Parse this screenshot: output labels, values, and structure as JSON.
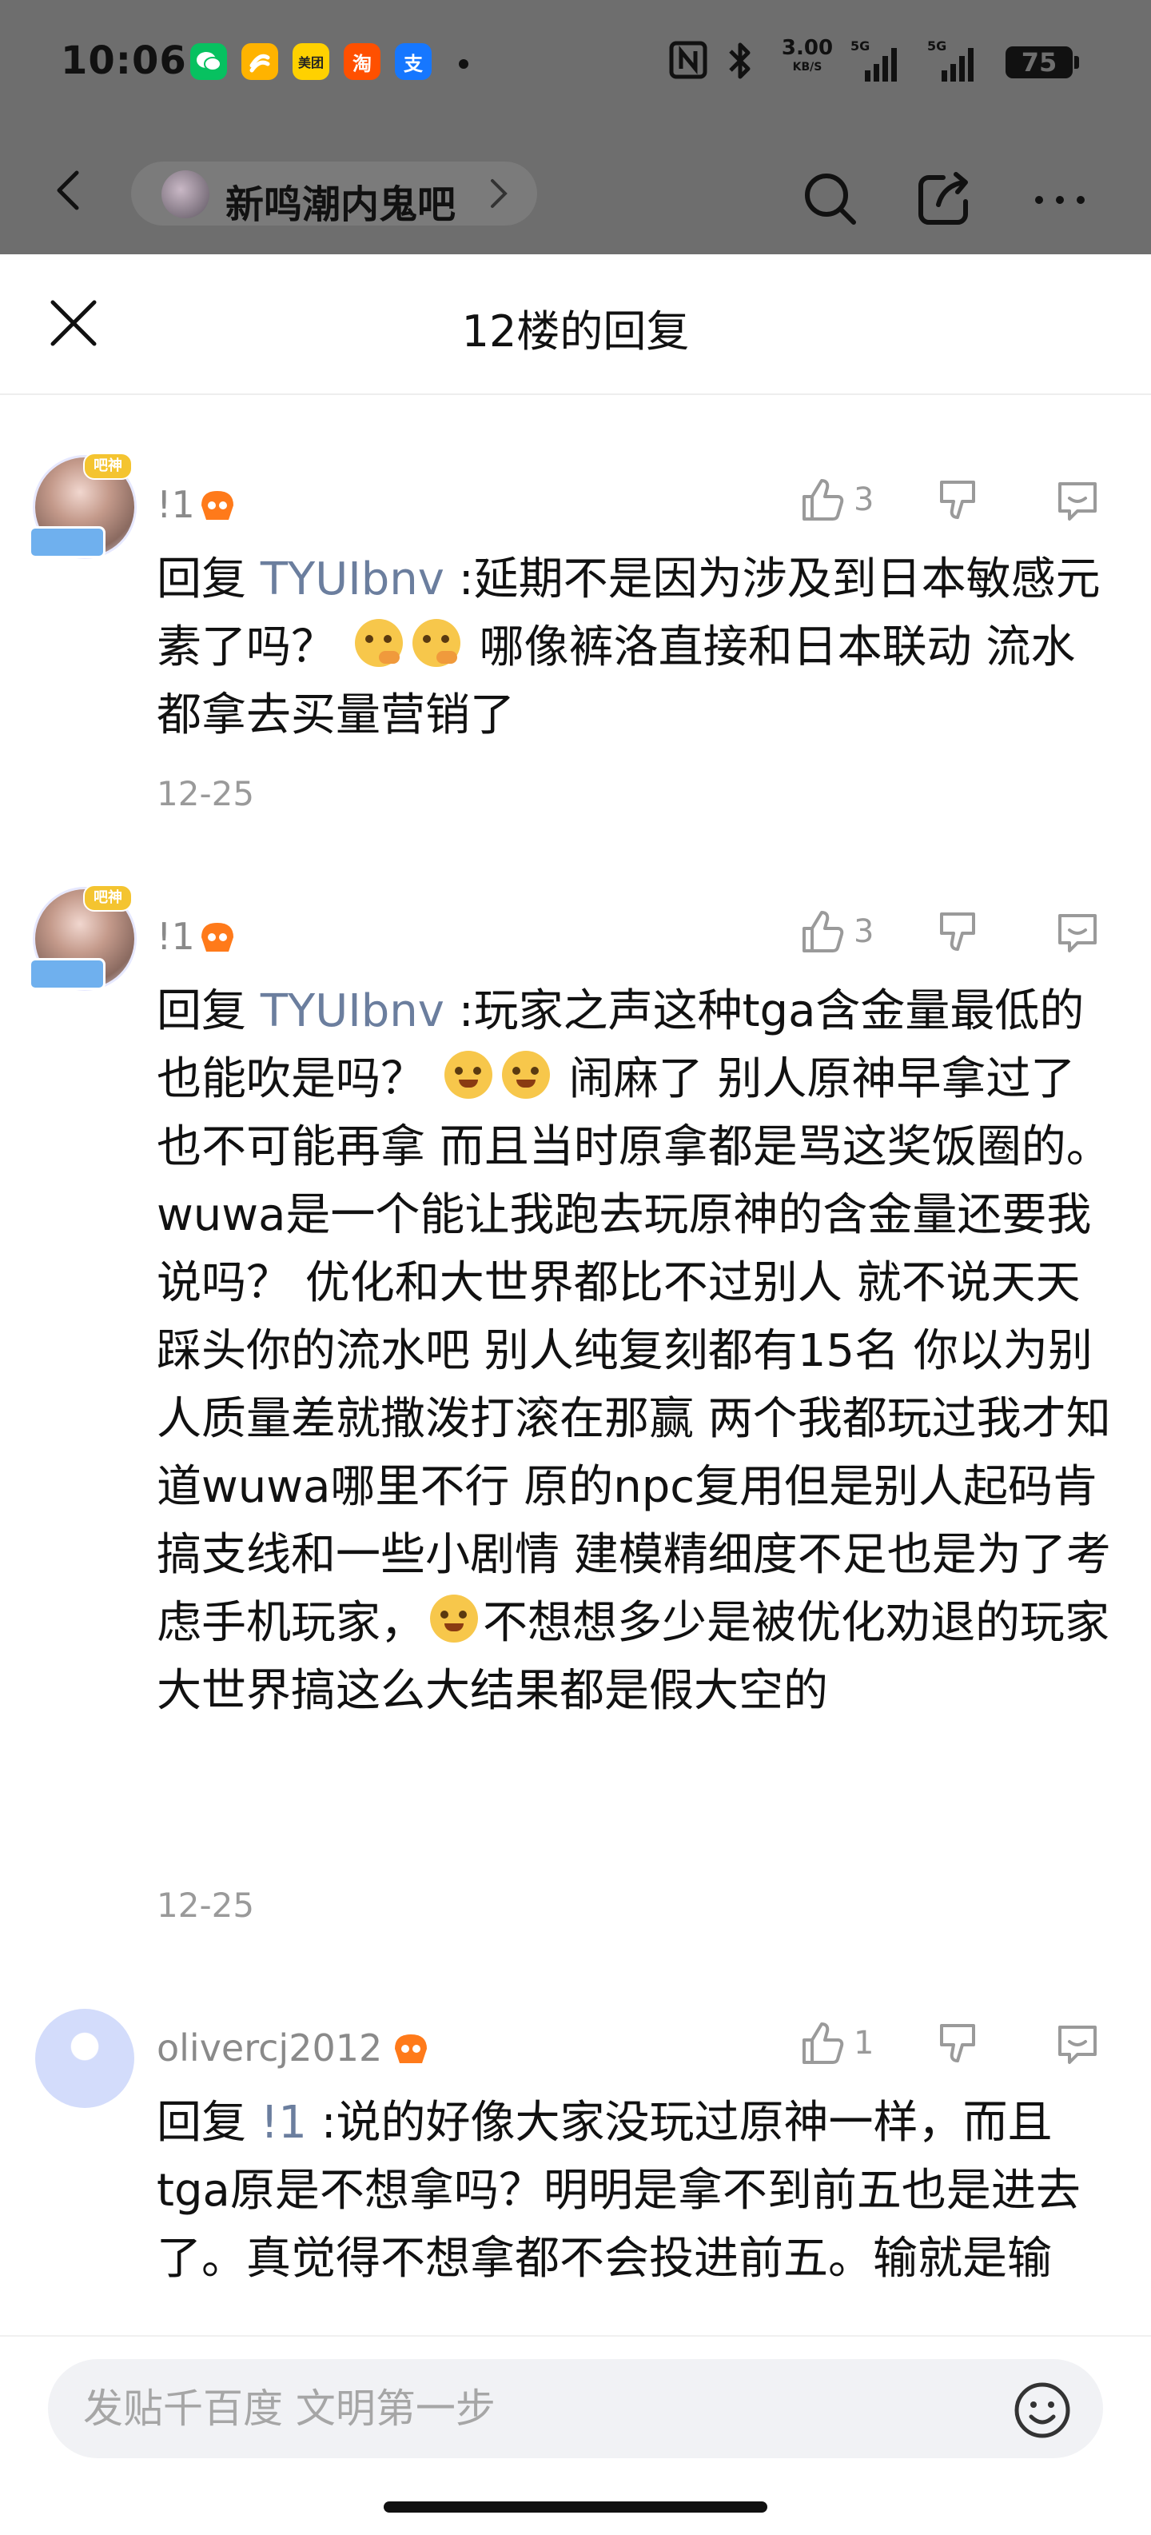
{
  "status_bar": {
    "time": "10:06",
    "app_icons": [
      {
        "name": "wechat",
        "color": "#07c160",
        "glyph": "◉"
      },
      {
        "name": "xianyu",
        "color": "#ffb300",
        "glyph": "≋"
      },
      {
        "name": "meituan",
        "color": "#ffd100",
        "glyph": "美团"
      },
      {
        "name": "taobao",
        "color": "#ff5000",
        "glyph": "淘"
      },
      {
        "name": "alipay",
        "color": "#1677ff",
        "glyph": "支"
      }
    ],
    "net_speed_value": "3.00",
    "net_speed_unit": "KB/S",
    "signal_1_label": "5G",
    "signal_2_label": "5G",
    "battery": "75"
  },
  "nav": {
    "forum_name": "新鸣潮内鬼吧"
  },
  "sheet": {
    "title": "12楼的回复"
  },
  "comments": [
    {
      "username": "!1",
      "likes": "3",
      "reply_keyword": "回复",
      "reply_to": "TYUIbnv",
      "text_a": " :延期不是因为涉及到日本敏感元素了吗？",
      "text_b": " 哪像裤洛直接和日本联动 流水都拿去买量营销了",
      "date": "12-25"
    },
    {
      "username": "!1",
      "likes": "3",
      "reply_keyword": "回复",
      "reply_to": "TYUIbnv",
      "text_a": " :玩家之声这种tga含金量最低的也能吹是吗？",
      "text_b": " 闹麻了 别人原神早拿过了也不可能再拿 而且当时原拿都是骂这奖饭圈的。 wuwa是一个能让我跑去玩原神的含金量还要我说吗？ 优化和大世界都比不过别人 就不说天天踩头你的流水吧 别人纯复刻都有15名 你以为别人质量差就撒泼打滚在那赢 两个我都玩过我才知道wuwa哪里不行 原的npc复用但是别人起码肯搞支线和一些小剧情 建模精细度不足也是为了考虑手机玩家，",
      "text_c": "不想想多少是被优化劝退的玩家 大世界搞这么大结果都是假大空的",
      "date": "12-25"
    },
    {
      "username": "olivercj2012",
      "likes": "1",
      "reply_keyword": "回复",
      "reply_to": "!1",
      "text_a": " :说的好像大家没玩过原神一样，而且tga原是不想拿吗？明明是拿不到前五也是进去了。真觉得不想拿都不会投进前五。输就是输"
    }
  ],
  "bottom_bar": {
    "input_placeholder": "发贴千百度 文明第一步"
  },
  "colors": {
    "dim_overlay": "#6e6e6e",
    "reply_user": "#6b7e9e",
    "meta_gray": "#9a9a9a",
    "input_bg": "#f1f2f5"
  }
}
